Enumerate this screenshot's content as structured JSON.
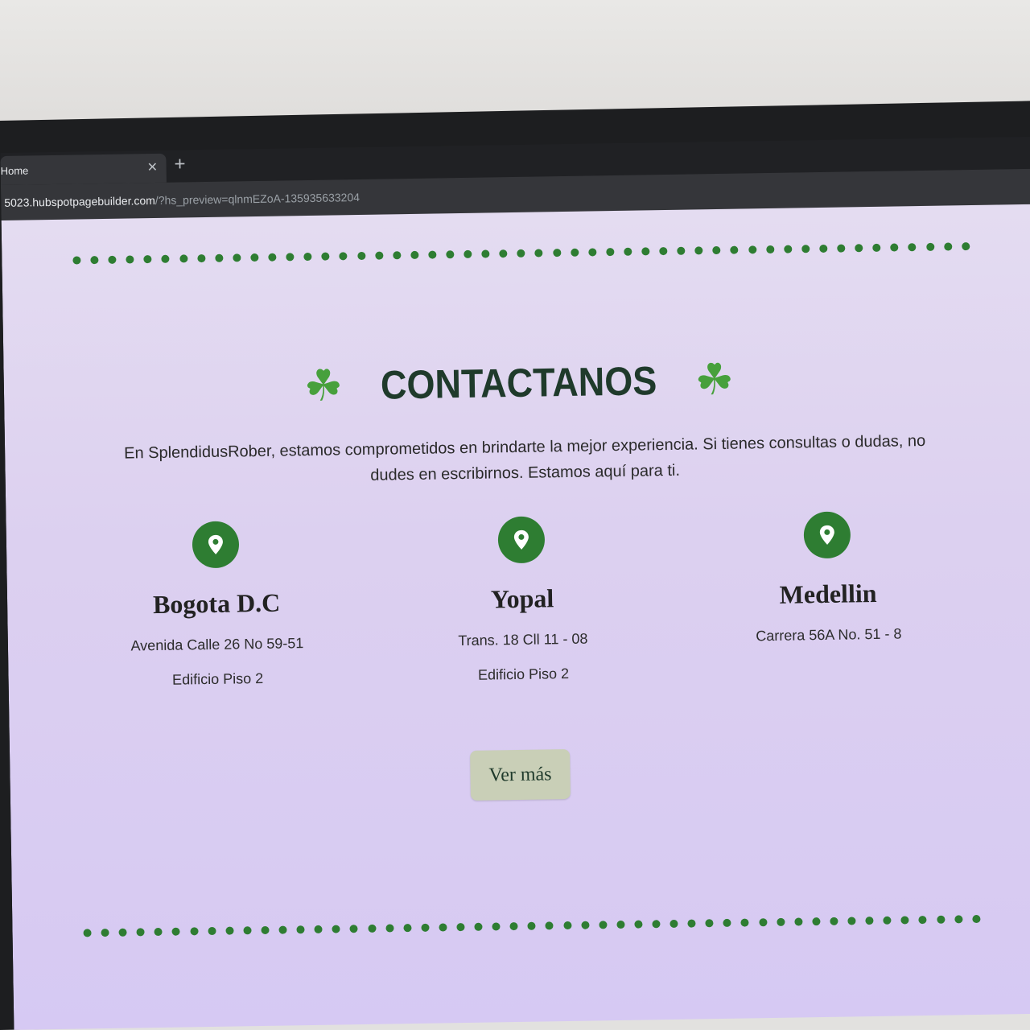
{
  "browser": {
    "tab_title": "Home",
    "url_host": "5023.hubspotpagebuilder.com",
    "url_path": "/?hs_preview=qlnmEZoA-135935633204"
  },
  "colors": {
    "accent_green": "#2e7d32",
    "heading_color": "#1f3a2b",
    "button_bg": "#c9cfb7"
  },
  "contact": {
    "title": "CONTACTANOS",
    "intro_line_1": "En SplendidusRober, estamos comprometidos en brindarte la mejor experiencia. Si tienes consultas o dudas, no",
    "intro_line_2": "dudes en escribirnos. Estamos aquí para ti.",
    "locations": [
      {
        "city": "Bogota D.C",
        "line1": "Avenida Calle 26 No 59-51",
        "line2": "Edificio  Piso 2"
      },
      {
        "city": "Yopal",
        "line1": "Trans. 18 Cll 11 - 08",
        "line2": "Edificio  Piso 2"
      },
      {
        "city": "Medellin",
        "line1": "Carrera 56A No. 51 - 8",
        "line2": ""
      }
    ],
    "button_label": "Ver más"
  },
  "icons": {
    "decoration": "clover-icon",
    "location": "map-pin-icon"
  }
}
